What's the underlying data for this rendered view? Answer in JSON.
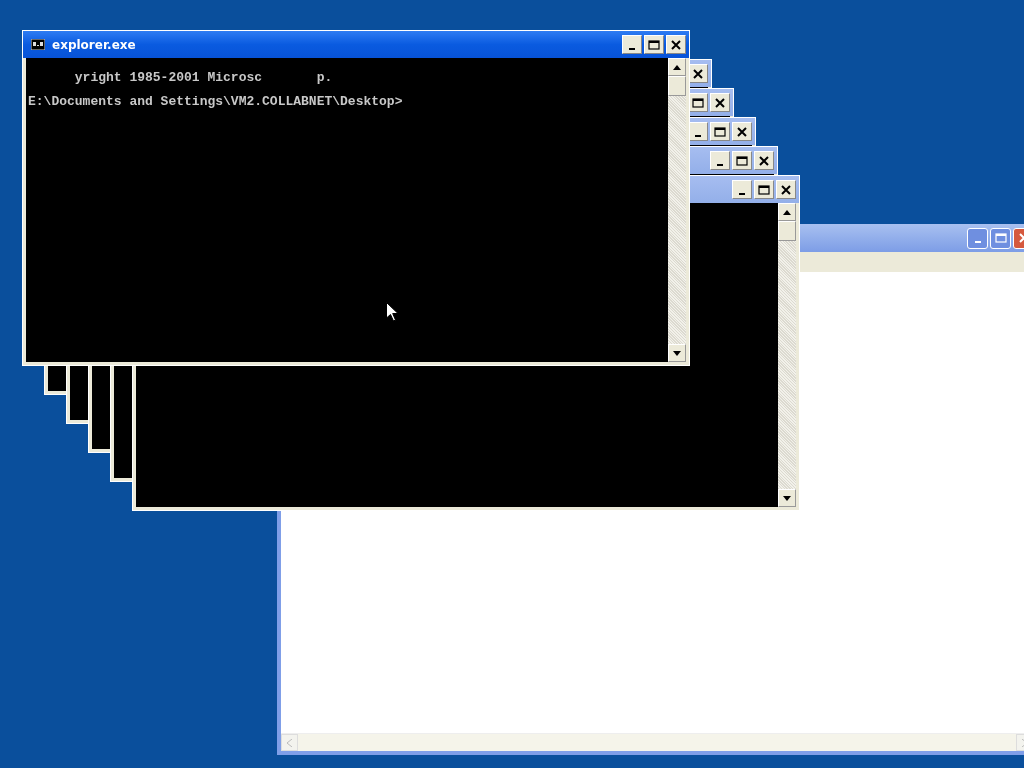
{
  "explorer_window": {
    "buttons": [
      {
        "kind": "minimize"
      },
      {
        "kind": "maximize"
      },
      {
        "kind": "close"
      }
    ]
  },
  "stacked_consoles": [
    {
      "buttons": [
        {
          "kind": "close"
        }
      ],
      "scrollbar": false
    },
    {
      "buttons": [
        {
          "kind": "maximize"
        },
        {
          "kind": "close"
        }
      ],
      "scrollbar": false
    },
    {
      "buttons": [
        {
          "kind": "minimize"
        },
        {
          "kind": "maximize"
        },
        {
          "kind": "close"
        }
      ],
      "scrollbar": false
    },
    {
      "buttons": [
        {
          "kind": "minimize"
        },
        {
          "kind": "maximize"
        },
        {
          "kind": "close"
        }
      ],
      "scrollbar": false
    },
    {
      "buttons": [
        {
          "kind": "minimize"
        },
        {
          "kind": "maximize"
        },
        {
          "kind": "close"
        }
      ],
      "scrollbar": true
    }
  ],
  "console_window": {
    "title": "explorer.exe",
    "lines": [
      "      yright 1985-2001 Microsc       p.",
      "E:\\Documents and Settings\\VM2.COLLABNET\\Desktop>"
    ],
    "buttons": [
      {
        "kind": "minimize"
      },
      {
        "kind": "maximize"
      },
      {
        "kind": "close"
      }
    ]
  }
}
